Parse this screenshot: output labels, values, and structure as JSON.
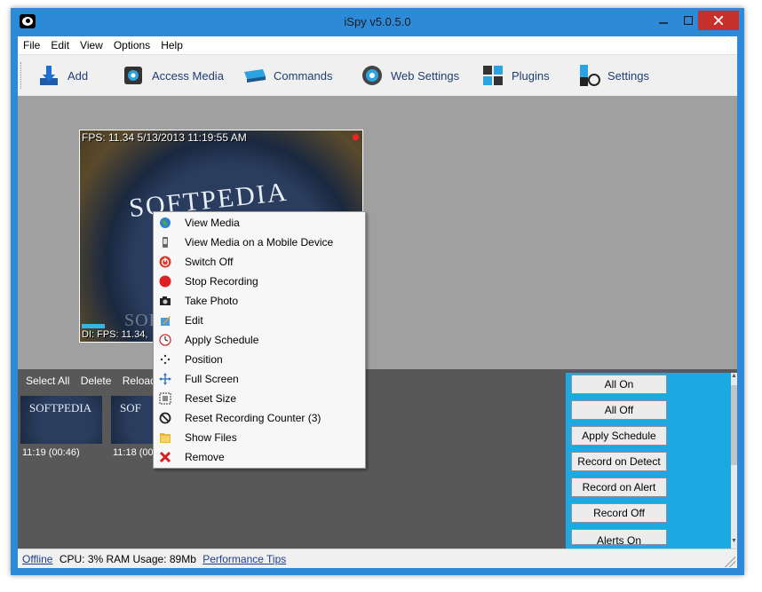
{
  "window": {
    "title": "iSpy v5.0.5.0"
  },
  "menu": [
    "File",
    "Edit",
    "View",
    "Options",
    "Help"
  ],
  "toolbar": [
    {
      "label": "Add",
      "icon": "add-camera-icon"
    },
    {
      "label": "Access Media",
      "icon": "media-icon"
    },
    {
      "label": "Commands",
      "icon": "commands-icon"
    },
    {
      "label": "Web Settings",
      "icon": "web-settings-icon"
    },
    {
      "label": "Plugins",
      "icon": "plugins-icon"
    },
    {
      "label": "Settings",
      "icon": "settings-icon"
    }
  ],
  "camera": {
    "overlay_top": "FPS: 11.34 5/13/2013 11:19:55 AM",
    "overlay_bottom": "DI: FPS: 11.34,",
    "image_text": "SOFTPEDIA"
  },
  "media_toolbar": [
    "Select All",
    "Delete",
    "Reload"
  ],
  "thumbnails": [
    {
      "caption": "11:19 (00:46)",
      "image_text": "SOFTPEDIA"
    },
    {
      "caption": "11:18 (00",
      "image_text": "SOF"
    }
  ],
  "context_menu": [
    {
      "label": "View Media",
      "icon": "globe-icon"
    },
    {
      "label": "View Media on a Mobile Device",
      "icon": "mobile-icon"
    },
    {
      "label": "Switch Off",
      "icon": "power-icon"
    },
    {
      "label": "Stop Recording",
      "icon": "record-icon"
    },
    {
      "label": "Take Photo",
      "icon": "camera-icon"
    },
    {
      "label": "Edit",
      "icon": "edit-icon"
    },
    {
      "label": "Apply Schedule",
      "icon": "schedule-icon"
    },
    {
      "label": "Position",
      "icon": "position-icon"
    },
    {
      "label": "Full Screen",
      "icon": "fullscreen-icon"
    },
    {
      "label": "Reset Size",
      "icon": "reset-size-icon"
    },
    {
      "label": "Reset Recording Counter (3)",
      "icon": "no-entry-icon"
    },
    {
      "label": "Show Files",
      "icon": "folder-icon"
    },
    {
      "label": "Remove",
      "icon": "remove-icon"
    }
  ],
  "command_buttons": [
    "All On",
    "All Off",
    "Apply Schedule",
    "Record on Detect",
    "Record on Alert",
    "Record Off",
    "Alerts On"
  ],
  "status": {
    "offline": "Offline",
    "cpu_ram": "CPU: 3% RAM Usage: 89Mb",
    "tips": "Performance Tips"
  },
  "colors": {
    "window_frame": "#2d8ad8",
    "close_button": "#c7302b",
    "command_panel": "#1aa9e2",
    "workspace": "#a0a0a0",
    "media_panel": "#585858",
    "recording_dot": "#ff2020"
  }
}
